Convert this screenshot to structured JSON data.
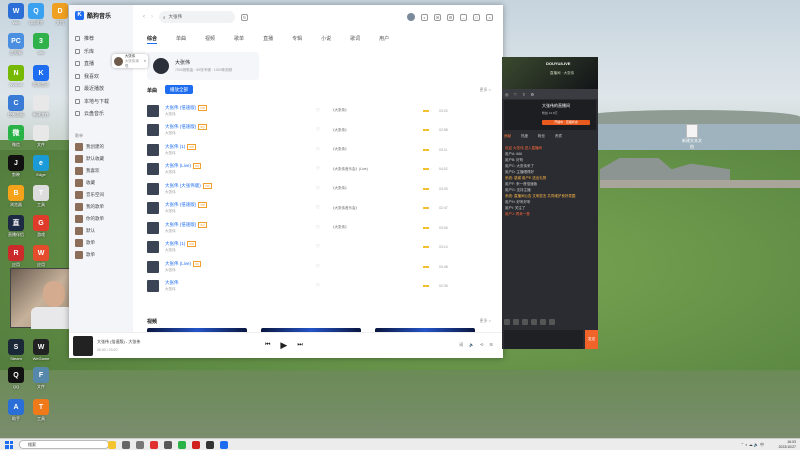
{
  "desktop": {
    "icons": [
      {
        "label": "Win",
        "color": "#2b6fd6",
        "glyph": "W"
      },
      {
        "label": "QQ浏览",
        "color": "#3aa0f0",
        "glyph": "Q"
      },
      {
        "label": "文档",
        "color": "#f0a020",
        "glyph": "D"
      },
      {
        "label": "此电脑",
        "color": "#4a8fe0",
        "glyph": "PC"
      },
      {
        "label": "360",
        "color": "#2fb24a",
        "glyph": "3"
      },
      {
        "label": "NVIDIA",
        "color": "#76b900",
        "glyph": "N"
      },
      {
        "label": "酷狗音乐",
        "color": "#1e6df0",
        "glyph": "K"
      },
      {
        "label": "控制面板",
        "color": "#3a7bd5",
        "glyph": "C"
      },
      {
        "label": "新建文件",
        "color": "#e8e8e8",
        "glyph": ""
      },
      {
        "label": "微信",
        "color": "#29b347",
        "glyph": "微"
      },
      {
        "label": "文件",
        "color": "#e8e8e8",
        "glyph": ""
      },
      {
        "label": "剪映",
        "color": "#111111",
        "glyph": "J"
      },
      {
        "label": "Edge",
        "color": "#1a9ad6",
        "glyph": "e"
      },
      {
        "label": "浏览器",
        "color": "#f6a21a",
        "glyph": "B"
      },
      {
        "label": "工具",
        "color": "#dddddd",
        "glyph": "T"
      },
      {
        "label": "直播伴侣",
        "color": "#1d2a44",
        "glyph": "直"
      },
      {
        "label": "游戏",
        "color": "#e03a2a",
        "glyph": "G"
      },
      {
        "label": "应用",
        "color": "#cc2b2b",
        "glyph": "R"
      },
      {
        "label": "应用",
        "color": "#e44c2c",
        "glyph": "W"
      },
      {
        "label": "Steam",
        "color": "#1b2838",
        "glyph": "S"
      },
      {
        "label": "WeGame",
        "color": "#222222",
        "glyph": "W"
      },
      {
        "label": "QQ",
        "color": "#111111",
        "glyph": "Q"
      },
      {
        "label": "文件",
        "color": "#5588aa",
        "glyph": "F"
      },
      {
        "label": "助手",
        "color": "#2a6fd8",
        "glyph": "A"
      },
      {
        "label": "工具",
        "color": "#f07a1a",
        "glyph": "T"
      }
    ],
    "right_file": "新建文本文档"
  },
  "music": {
    "app_name": "酷狗音乐",
    "search_placeholder": "大张伟",
    "nav": [
      "推荐",
      "乐库",
      "直播",
      "我喜欢",
      "最近播放",
      "本地与下载",
      "云盘音乐"
    ],
    "section_label": "歌单",
    "playlists": [
      "我创建的",
      "默认收藏",
      "我喜欢",
      "收藏",
      "音乐空间",
      "我的歌单",
      "你的歌单",
      "默认",
      "歌单",
      "歌单"
    ],
    "tooltip": {
      "name": "大张伟",
      "sub": "大张伟演唱"
    },
    "tabs": [
      "综合",
      "单曲",
      "视频",
      "歌单",
      "直播",
      "专辑",
      "小说",
      "歌词",
      "用户"
    ],
    "artist": {
      "name": "大张伟",
      "sub": "7000首歌曲 · 89张专辑 · 1000条视频"
    },
    "singles_label": "单曲",
    "play_all": "播放全部",
    "more": "更多 >",
    "songs": [
      {
        "title": "大张伟 (倍速版)",
        "tag": "VIP",
        "artist": "大张伟",
        "album": "《大张伟》",
        "duration": "03:20"
      },
      {
        "title": "大张伟 (倍速版)",
        "tag": "SQ",
        "artist": "大张伟",
        "album": "《大张伟》",
        "duration": "02:58"
      },
      {
        "title": "大张伟 (1)",
        "tag": "VIP",
        "artist": "大张伟",
        "album": "《大张伟》",
        "duration": "03:11"
      },
      {
        "title": "大张伟 (Live)",
        "tag": "SQ",
        "artist": "大张伟",
        "album": "《大张伟音乐会》(Live)",
        "duration": "04:02"
      },
      {
        "title": "大张伟 (大张伟版)",
        "tag": "VIP",
        "artist": "大张伟",
        "album": "《大张伟》",
        "duration": "03:33"
      },
      {
        "title": "大张伟 (倍速版)",
        "tag": "VIP",
        "artist": "大张伟",
        "album": "《大张伟音乐会》",
        "duration": "02:47"
      },
      {
        "title": "大张伟 (倍速版)",
        "tag": "SQ",
        "artist": "大张伟",
        "album": "《大张伟》",
        "duration": "03:05"
      },
      {
        "title": "大张伟 (1)",
        "tag": "VIP",
        "artist": "大张伟",
        "album": "",
        "duration": "03:14"
      },
      {
        "title": "大张伟 (Live)",
        "tag": "SQ",
        "artist": "大张伟",
        "album": "",
        "duration": "03:48"
      },
      {
        "title": "大张伟",
        "tag": "",
        "artist": "大张伟",
        "album": "",
        "duration": "02:39"
      }
    ],
    "videos_label": "视频",
    "player": {
      "title": "大张伟 (倍速版) - 大张伟",
      "sub": "00:00 / 03:20"
    }
  },
  "stream": {
    "title": "DOUYU/LIVE",
    "sub": "直播间 · 大张伟",
    "live_label": "开播中 · 直播状态",
    "card_title": "大张伟的直播间",
    "card_sub": "粉丝 12.8万",
    "tabs": [
      "贡献",
      "热度",
      "粉丝",
      "贵宾"
    ],
    "chat": [
      {
        "t": "欢迎 大张伟 进入直播间",
        "c": "r"
      },
      {
        "t": "用户A: 666",
        "c": ""
      },
      {
        "t": "用户B: 好听",
        "c": ""
      },
      {
        "t": "用户C: 大张伟来了",
        "c": ""
      },
      {
        "t": "用户D: 主播唱得好",
        "c": ""
      },
      {
        "t": "系统: 感谢 用户E 送出礼物",
        "c": "y"
      },
      {
        "t": "用户F: 来一首倍速版",
        "c": ""
      },
      {
        "t": "用户G: 支持主播",
        "c": ""
      },
      {
        "t": "系统: 直播间公告 文明发言 共同维护良好氛围",
        "c": "y"
      },
      {
        "t": "用户H: 好听好听",
        "c": ""
      },
      {
        "t": "用户I: 关注了",
        "c": ""
      },
      {
        "t": "用户J: 再来一首",
        "c": "r"
      }
    ],
    "send": "发送"
  },
  "taskbar": {
    "search": "搜索",
    "time": "16:03",
    "date": "2023/10/27"
  }
}
